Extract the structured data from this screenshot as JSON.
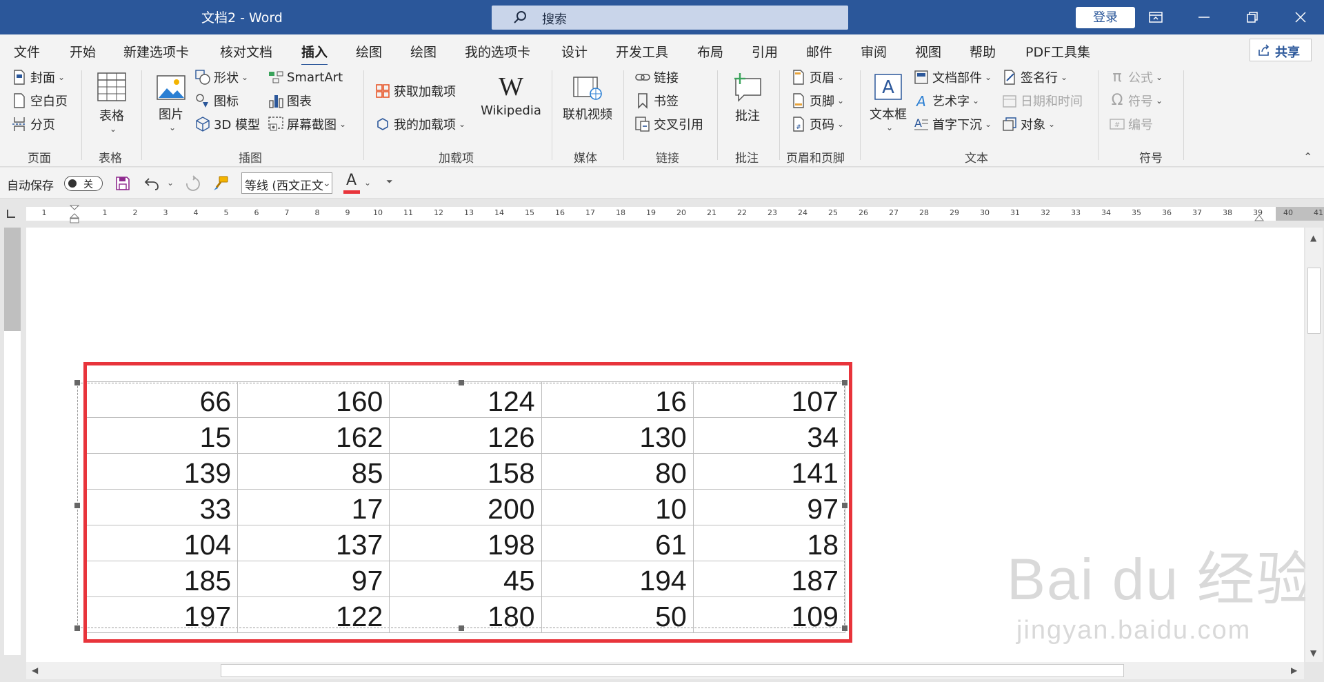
{
  "app": {
    "title": "文档2  -  Word",
    "search_placeholder": "搜索",
    "login_label": "登录",
    "share_label": "共享",
    "accent_color": "#2b579a"
  },
  "tabs": [
    "文件",
    "开始",
    "新建选项卡",
    "核对文档",
    "插入",
    "绘图",
    "绘图",
    "我的选项卡",
    "设计",
    "开发工具",
    "布局",
    "引用",
    "邮件",
    "审阅",
    "视图",
    "帮助",
    "PDF工具集"
  ],
  "active_tab": "插入",
  "ribbon": {
    "pages": {
      "cover": "封面",
      "blank": "空白页",
      "break": "分页",
      "group": "页面"
    },
    "tables": {
      "table": "表格",
      "group": "表格"
    },
    "illustrations": {
      "picture": "图片",
      "shapes": "形状",
      "icons": "图标",
      "model3d": "3D 模型",
      "smartart": "SmartArt",
      "chart": "图表",
      "screenshot": "屏幕截图",
      "group": "插图"
    },
    "addins": {
      "get": "获取加载项",
      "mine": "我的加载项",
      "wikipedia": "Wikipedia",
      "group": "加载项"
    },
    "media": {
      "video": "联机视频",
      "group": "媒体"
    },
    "links": {
      "link": "链接",
      "bookmark": "书签",
      "crossref": "交叉引用",
      "group": "链接"
    },
    "comments": {
      "comment": "批注",
      "group": "批注"
    },
    "headerfooter": {
      "header": "页眉",
      "footer": "页脚",
      "pagenum": "页码",
      "group": "页眉和页脚"
    },
    "text": {
      "textbox": "文本框",
      "quickparts": "文档部件",
      "wordart": "艺术字",
      "dropcap": "首字下沉",
      "signature": "签名行",
      "datetime": "日期和时间",
      "object": "对象",
      "group": "文本"
    },
    "symbols": {
      "equation": "公式",
      "symbol": "符号",
      "number": "编号",
      "group": "符号"
    }
  },
  "qat": {
    "autosave_label": "自动保存",
    "autosave_state": "关",
    "font_name": "等线 (西文正文",
    "font_color": "#e8343b"
  },
  "ruler": {
    "numbers": [
      "1",
      "1",
      "2",
      "3",
      "4",
      "5",
      "6",
      "7",
      "8",
      "9",
      "10",
      "11",
      "12",
      "13",
      "14",
      "15",
      "16",
      "17",
      "18",
      "19",
      "20",
      "21",
      "22",
      "23",
      "24",
      "25",
      "26",
      "27",
      "28",
      "29",
      "30",
      "31",
      "32",
      "33",
      "34",
      "35",
      "36",
      "37",
      "38",
      "39",
      "40",
      "41"
    ]
  },
  "table": {
    "rows": [
      [
        "66",
        "160",
        "124",
        "16",
        "107"
      ],
      [
        "15",
        "162",
        "126",
        "130",
        "34"
      ],
      [
        "139",
        "85",
        "158",
        "80",
        "141"
      ],
      [
        "33",
        "17",
        "200",
        "10",
        "97"
      ],
      [
        "104",
        "137",
        "198",
        "61",
        "18"
      ],
      [
        "185",
        "97",
        "45",
        "194",
        "187"
      ],
      [
        "197",
        "122",
        "180",
        "50",
        "109"
      ]
    ],
    "highlight_color": "#e8343b"
  },
  "watermark": {
    "main": "Bai du 经验",
    "sub": "jingyan.baidu.com"
  }
}
